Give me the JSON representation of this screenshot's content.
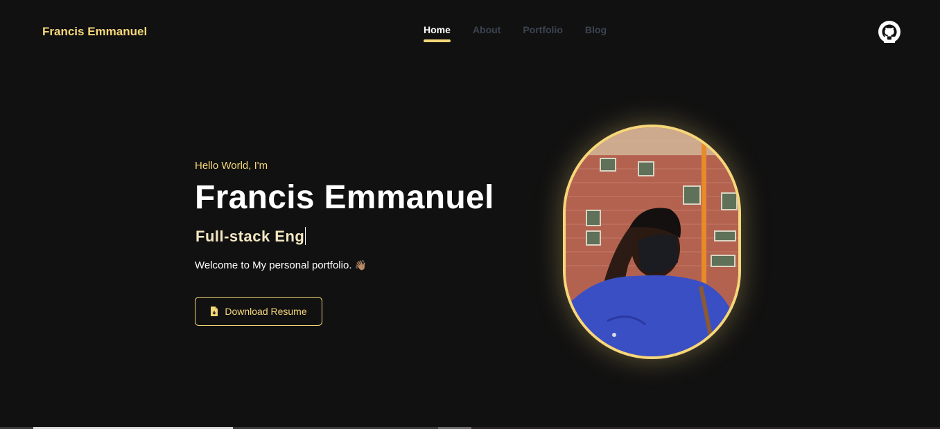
{
  "header": {
    "brand": "Francis Emmanuel",
    "nav": [
      {
        "label": "Home",
        "active": true
      },
      {
        "label": "About",
        "active": false
      },
      {
        "label": "Portfolio",
        "active": false
      },
      {
        "label": "Blog",
        "active": false
      }
    ],
    "github_icon": "github-icon"
  },
  "hero": {
    "greeting": "Hello World, I'm",
    "name": "Francis Emmanuel",
    "role_typed": "Full-stack Eng",
    "welcome": "Welcome to My personal portfolio.",
    "wave_emoji": "👋🏽",
    "resume_button": "Download Resume",
    "resume_icon": "file-download-icon"
  },
  "colors": {
    "background": "#111111",
    "accent": "#f6d77a",
    "nav_inactive": "#3c4452"
  }
}
